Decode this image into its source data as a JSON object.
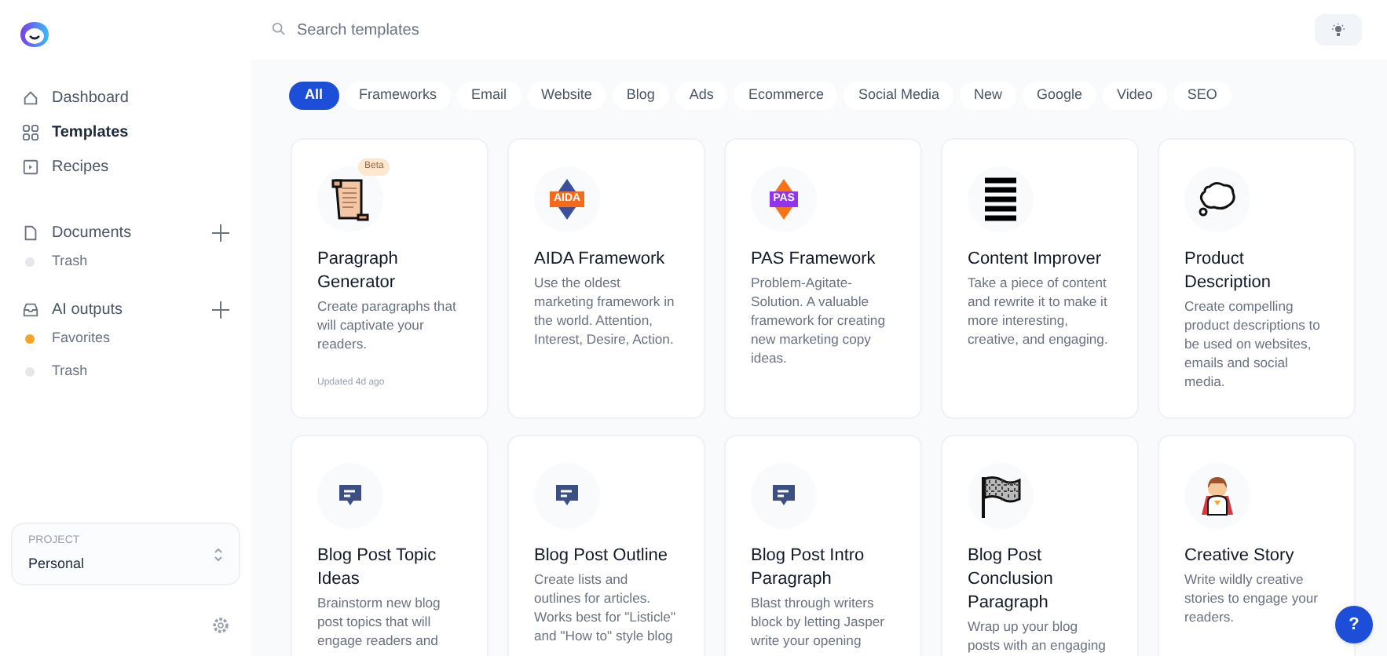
{
  "sidebar": {
    "nav": [
      {
        "label": "Dashboard",
        "selected": false
      },
      {
        "label": "Templates",
        "selected": true
      },
      {
        "label": "Recipes",
        "selected": false
      }
    ],
    "sections": [
      {
        "title": "Documents",
        "items": [
          {
            "label": "Trash",
            "color": "#e5e7eb"
          }
        ]
      },
      {
        "title": "AI outputs",
        "items": [
          {
            "label": "Favorites",
            "color": "#f5a524"
          },
          {
            "label": "Trash",
            "color": "#e5e7eb"
          }
        ]
      }
    ],
    "project": {
      "label": "PROJECT",
      "value": "Personal"
    }
  },
  "search": {
    "placeholder": "Search templates"
  },
  "filters": [
    {
      "label": "All",
      "selected": true
    },
    {
      "label": "Frameworks",
      "selected": false
    },
    {
      "label": "Email",
      "selected": false
    },
    {
      "label": "Website",
      "selected": false
    },
    {
      "label": "Blog",
      "selected": false
    },
    {
      "label": "Ads",
      "selected": false
    },
    {
      "label": "Ecommerce",
      "selected": false
    },
    {
      "label": "Social Media",
      "selected": false
    },
    {
      "label": "New",
      "selected": false
    },
    {
      "label": "Google",
      "selected": false
    },
    {
      "label": "Video",
      "selected": false
    },
    {
      "label": "SEO",
      "selected": false
    }
  ],
  "templates": [
    {
      "title": "Paragraph Generator",
      "description": "Create paragraphs that will captivate your readers.",
      "badge": "Beta",
      "updated": "Updated 4d ago"
    },
    {
      "title": "AIDA Framework",
      "description": "Use the oldest marketing framework in the world. Attention, Interest, Desire, Action.",
      "logo_text": "AIDA"
    },
    {
      "title": "PAS Framework",
      "description": "Problem-Agitate-Solution. A valuable framework for creating new marketing copy ideas.",
      "logo_text": "PAS"
    },
    {
      "title": "Content Improver",
      "description": "Take a piece of content and rewrite it to make it more interesting, creative, and engaging."
    },
    {
      "title": "Product Description",
      "description": "Create compelling product descriptions to be used on websites, emails and social media."
    },
    {
      "title": "Blog Post Topic Ideas",
      "description": "Brainstorm new blog post topics that will engage readers and"
    },
    {
      "title": "Blog Post Outline",
      "description": "Create lists and outlines for articles. Works best for \"Listicle\" and \"How to\" style blog"
    },
    {
      "title": "Blog Post Intro Paragraph",
      "description": "Blast through writers block by letting Jasper write your opening"
    },
    {
      "title": "Blog Post Conclusion Paragraph",
      "description": "Wrap up your blog posts with an engaging"
    },
    {
      "title": "Creative Story",
      "description": "Write wildly creative stories to engage your readers."
    }
  ],
  "help": {
    "label": "?"
  }
}
